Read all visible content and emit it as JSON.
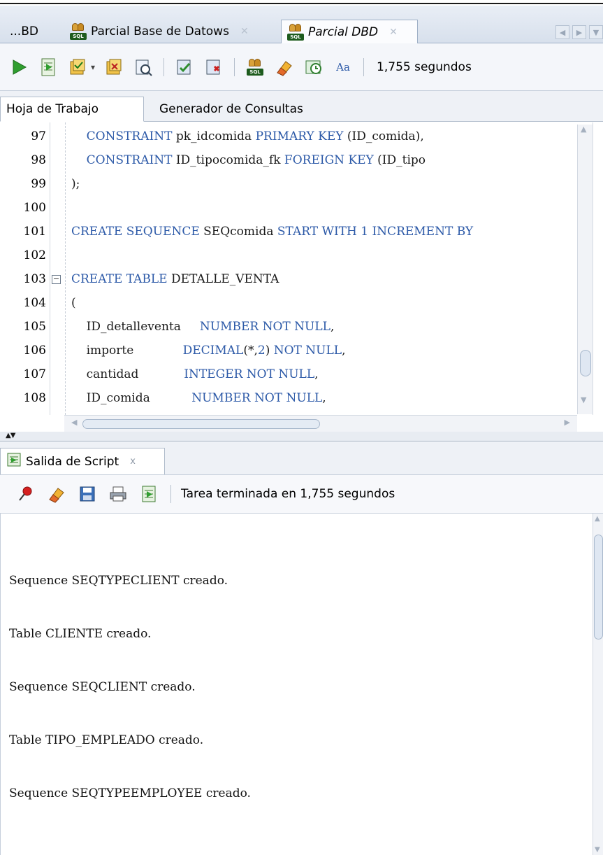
{
  "editor_tabs": [
    {
      "label": "...BD"
    },
    {
      "label": "Parcial Base de Datows"
    },
    {
      "label": "Parcial DBD"
    }
  ],
  "toolbar": {
    "elapsed": "1,755 segundos"
  },
  "worksheet_tabs": [
    {
      "label": "Hoja de Trabajo"
    },
    {
      "label": "Generador de Consultas"
    }
  ],
  "code_lines": [
    {
      "num": "97",
      "text": "    CONSTRAINT pk_idcomida PRIMARY KEY (ID_comida),"
    },
    {
      "num": "98",
      "text": "    CONSTRAINT ID_tipocomida_fk FOREIGN KEY (ID_tipo"
    },
    {
      "num": "99",
      "text": ");"
    },
    {
      "num": "100",
      "text": ""
    },
    {
      "num": "101",
      "text": "CREATE SEQUENCE SEQcomida START WITH 1 INCREMENT BY"
    },
    {
      "num": "102",
      "text": ""
    },
    {
      "num": "103",
      "text": "CREATE TABLE DETALLE_VENTA"
    },
    {
      "num": "104",
      "text": "("
    },
    {
      "num": "105",
      "text": "    ID_detalleventa     NUMBER NOT NULL,"
    },
    {
      "num": "106",
      "text": "    importe             DECIMAL(*,2) NOT NULL,"
    },
    {
      "num": "107",
      "text": "    cantidad            INTEGER NOT NULL,"
    },
    {
      "num": "108",
      "text": "    ID_comida           NUMBER NOT NULL,"
    }
  ],
  "output_panel": {
    "tab_label": "Salida de Script",
    "tab_close": "x",
    "status": "Tarea terminada en 1,755 segundos",
    "lines": [
      "Sequence SEQTYPECLIENT creado.",
      "Table CLIENTE creado.",
      "Sequence SEQCLIENT creado.",
      "Table TIPO_EMPLEADO creado.",
      "Sequence SEQTYPEEMPLOYEE creado."
    ]
  },
  "icons": {
    "run": "run-statement-icon",
    "script": "run-script-icon",
    "sql_badge": "SQL"
  },
  "colors": {
    "keyword": "#2d5aa8",
    "tab_bar": "#d7e0ec",
    "run_green": "#2f9e2f"
  }
}
